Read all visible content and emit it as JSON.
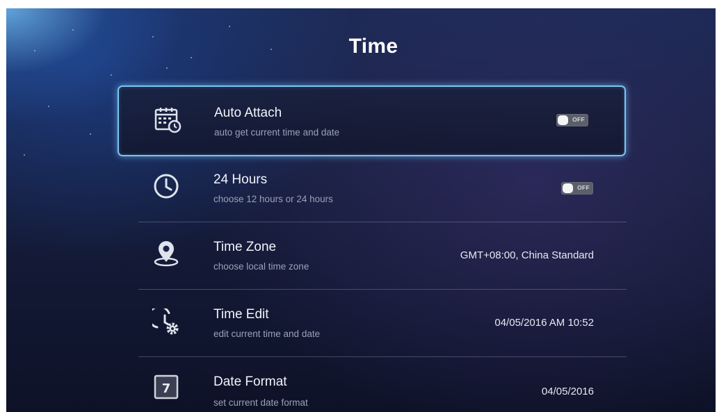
{
  "page": {
    "title": "Time"
  },
  "settings": [
    {
      "id": "auto-attach",
      "label": "Auto Attach",
      "sub": "auto get current time and date",
      "toggle": "OFF",
      "icon": "calendar-clock-icon"
    },
    {
      "id": "24-hours",
      "label": "24 Hours",
      "sub": "choose 12 hours or 24 hours",
      "toggle": "OFF",
      "icon": "clock-icon"
    },
    {
      "id": "time-zone",
      "label": "Time Zone",
      "sub": "choose local time zone",
      "value": "GMT+08:00, China Standard",
      "icon": "location-pin-icon"
    },
    {
      "id": "time-edit",
      "label": "Time Edit",
      "sub": "edit current time and date",
      "value": "04/05/2016 AM 10:52",
      "icon": "clock-gear-icon"
    },
    {
      "id": "date-format",
      "label": "Date Format",
      "sub": "set current date format",
      "value": "04/05/2016",
      "icon": "calendar-day-icon",
      "icon_text": "7"
    }
  ],
  "colors": {
    "focus_border": "#7cc4f0",
    "text_primary": "#f2f4fa",
    "text_secondary": "#9aa1b8",
    "toggle_bg": "#5a5f6a"
  }
}
